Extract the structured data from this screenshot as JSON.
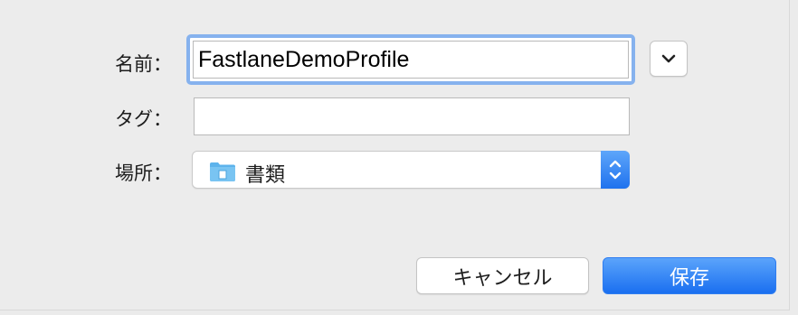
{
  "form": {
    "name_label": "名前：",
    "name_value": "FastlaneDemoProfile",
    "tags_label": "タグ：",
    "tags_value": "",
    "location_label": "場所：",
    "location_value": "書類"
  },
  "buttons": {
    "cancel_label": "キャンセル",
    "save_label": "保存"
  },
  "icons": {
    "expand": "chevron-down-icon",
    "folder": "folder-icon",
    "stepper": "up-down-chevron-icon"
  },
  "colors": {
    "accent": "#1f72ee",
    "focus_ring": "#86b2ee",
    "folder": "#5db3ec",
    "background": "#ececec"
  }
}
